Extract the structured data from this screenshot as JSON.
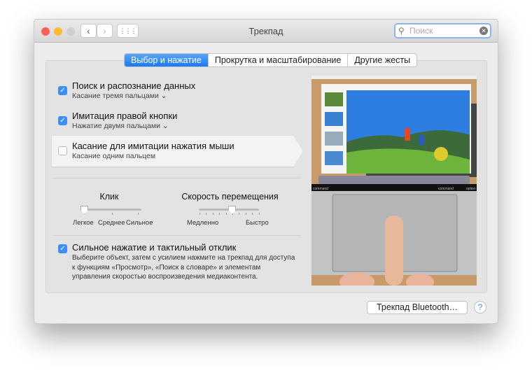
{
  "window": {
    "title": "Трекпад",
    "search_placeholder": "Поиск",
    "back": "‹",
    "forward": "›",
    "grid": "⋮⋮⋮"
  },
  "tabs": [
    {
      "label": "Выбор и нажатие",
      "active": true
    },
    {
      "label": "Прокрутка и масштабирование"
    },
    {
      "label": "Другие жесты"
    }
  ],
  "options": [
    {
      "title": "Поиск и распознание данных",
      "sub": "Касание тремя пальцами",
      "checked": true,
      "dropdown": true
    },
    {
      "title": "Имитация правой кнопки",
      "sub": "Нажатие двумя пальцами",
      "checked": true,
      "dropdown": true
    },
    {
      "title": "Касание для имитации нажатия мыши",
      "sub": "Касание одним пальцем",
      "checked": false
    }
  ],
  "click": {
    "label": "Клик",
    "labels": [
      "Легкое",
      "Среднее",
      "Сильное"
    ],
    "value": "Легкое"
  },
  "speed": {
    "label": "Скорость перемещения",
    "min": "Медленно",
    "max": "Быстро",
    "value_fraction": 0.55
  },
  "force": {
    "title": "Сильное нажатие и тактильный отклик",
    "checked": true,
    "desc": "Выберите объект, затем с усилием нажмите на трекпад для доступа к функциям «Просмотр», «Поиск в словаре» и элементам управления скоростью воспроизведения медиаконтента."
  },
  "preview": {
    "key_left": "command",
    "key_right": "command",
    "key_far": "option"
  },
  "footer": {
    "bluetooth": "Трекпад Bluetooth…",
    "help": "?"
  },
  "colors": {
    "accent": "#1a79f1"
  }
}
